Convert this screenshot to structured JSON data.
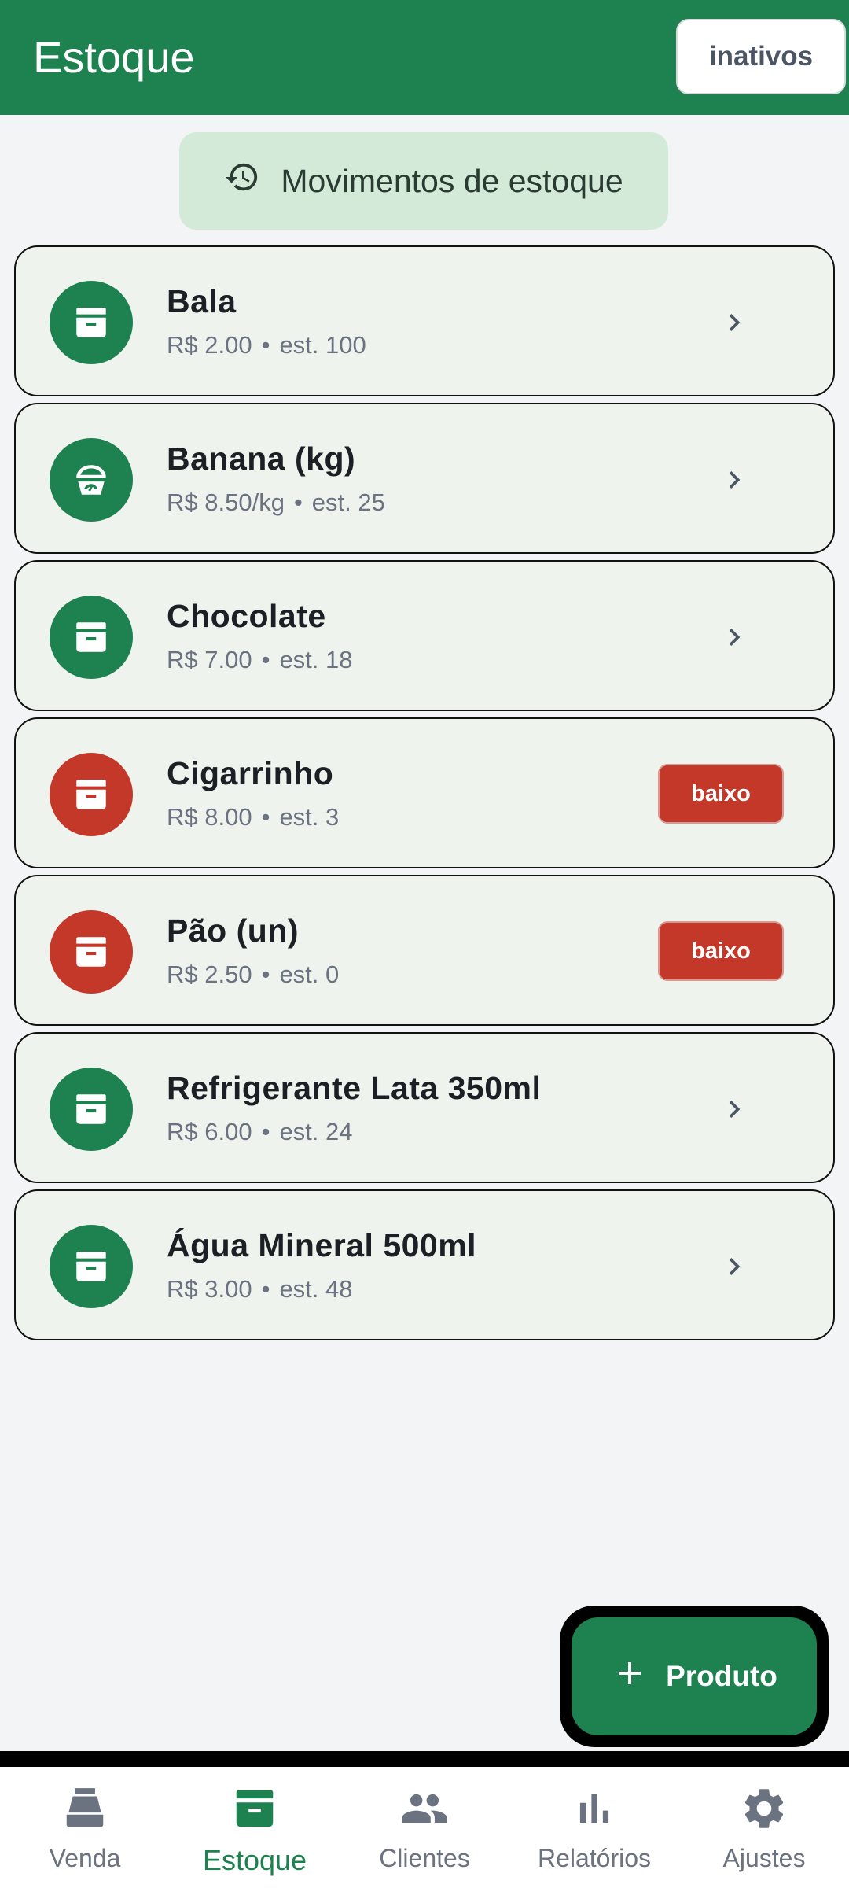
{
  "header": {
    "title": "Estoque",
    "inactive_button": "inativos"
  },
  "movements_button": {
    "label": "Movimentos de estoque",
    "icon": "history-icon"
  },
  "products": [
    {
      "name": "Bala",
      "price": "R$ 2.00",
      "stock": "est. 100",
      "icon": "archive-icon",
      "status": "ok",
      "badge": ""
    },
    {
      "name": "Banana (kg)",
      "price": "R$ 8.50/kg",
      "stock": "est. 25",
      "icon": "scale-icon",
      "status": "ok",
      "badge": ""
    },
    {
      "name": "Chocolate",
      "price": "R$ 7.00",
      "stock": "est. 18",
      "icon": "archive-icon",
      "status": "ok",
      "badge": ""
    },
    {
      "name": "Cigarrinho",
      "price": "R$ 8.00",
      "stock": "est. 3",
      "icon": "archive-icon",
      "status": "low",
      "badge": "baixo"
    },
    {
      "name": "Pão (un)",
      "price": "R$ 2.50",
      "stock": "est. 0",
      "icon": "archive-icon",
      "status": "low",
      "badge": "baixo"
    },
    {
      "name": "Refrigerante Lata 350ml",
      "price": "R$ 6.00",
      "stock": "est. 24",
      "icon": "archive-icon",
      "status": "ok",
      "badge": ""
    },
    {
      "name": "Água Mineral 500ml",
      "price": "R$ 3.00",
      "stock": "est. 48",
      "icon": "archive-icon",
      "status": "ok",
      "badge": ""
    }
  ],
  "separator": "•",
  "fab": {
    "label": "Produto",
    "icon": "plus-icon"
  },
  "bottom_nav": [
    {
      "label": "Venda",
      "icon": "cash-register-icon",
      "active": false
    },
    {
      "label": "Estoque",
      "icon": "archive-icon",
      "active": true
    },
    {
      "label": "Clientes",
      "icon": "people-icon",
      "active": false
    },
    {
      "label": "Relatórios",
      "icon": "bar-chart-icon",
      "active": false
    },
    {
      "label": "Ajustes",
      "icon": "gear-icon",
      "active": false
    }
  ],
  "colors": {
    "primary": "#1d8150",
    "low_stock": "#c4382a",
    "nav_inactive": "#6b7280",
    "card_bg": "#eff3ee"
  }
}
